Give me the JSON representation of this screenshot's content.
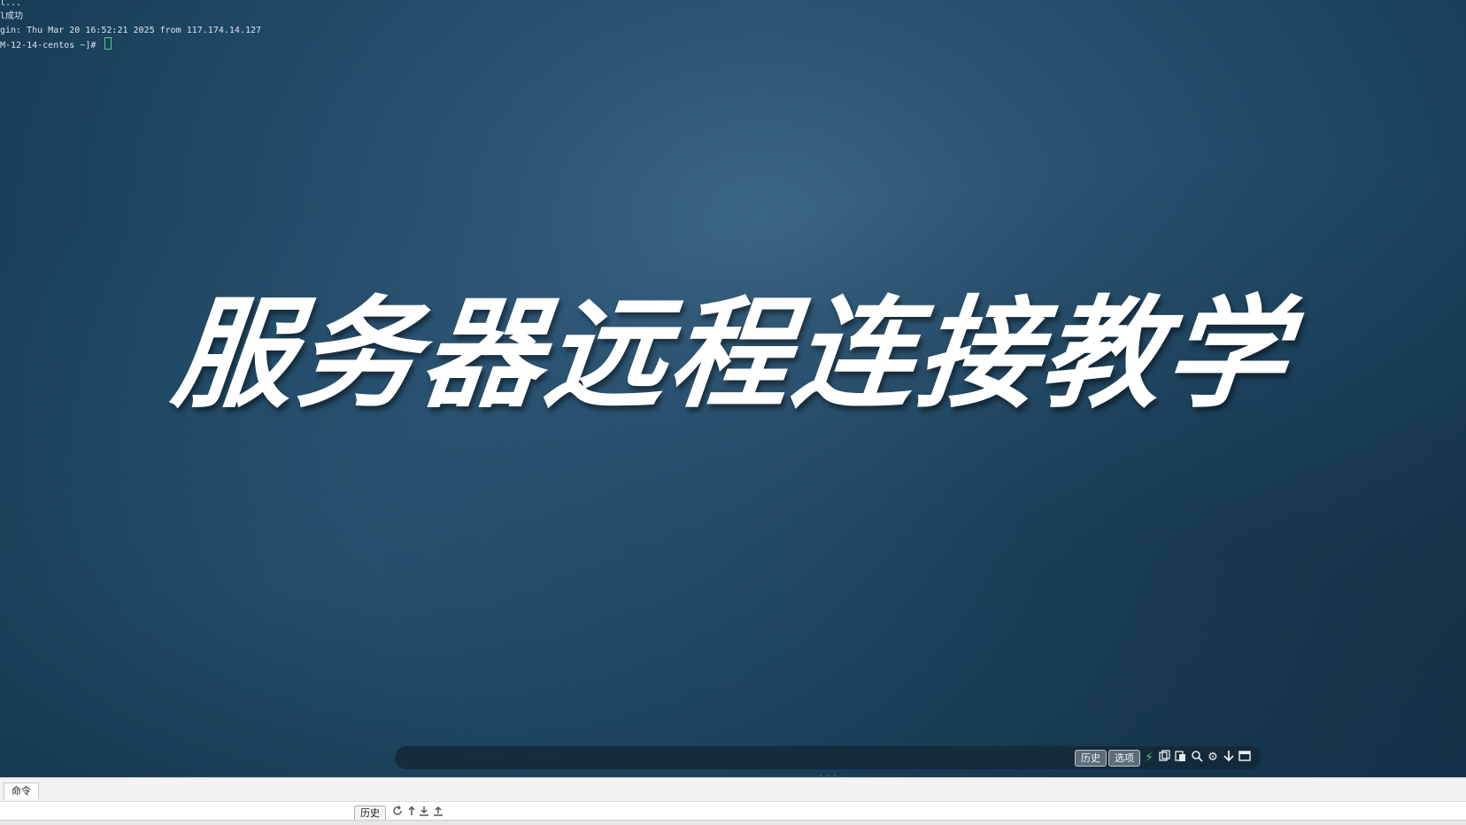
{
  "terminal": {
    "lines": [
      "l...",
      "l成功",
      "gin: Thu Mar 20 16:52:21 2025 from 117.174.14.127",
      "M-12-14-centos ~]# "
    ],
    "cursor_color": "#4ad08a"
  },
  "overlay": {
    "title": "服务器远程连接教学"
  },
  "float_toolbar": {
    "history_label": "历史",
    "options_label": "选项",
    "icons": [
      "bolt-icon",
      "copy-icon",
      "paste-icon",
      "search-icon",
      "gear-icon",
      "arrow-down-icon",
      "window-icon"
    ]
  },
  "command_panel": {
    "tab_label": "命令",
    "history_label": "历史",
    "icons": [
      "refresh-icon",
      "arrow-up-icon",
      "download-icon",
      "upload-icon"
    ]
  },
  "colors": {
    "terminal_bg": "#1f4763",
    "title_text": "#ffffff",
    "accent_green": "#3fd35a"
  }
}
